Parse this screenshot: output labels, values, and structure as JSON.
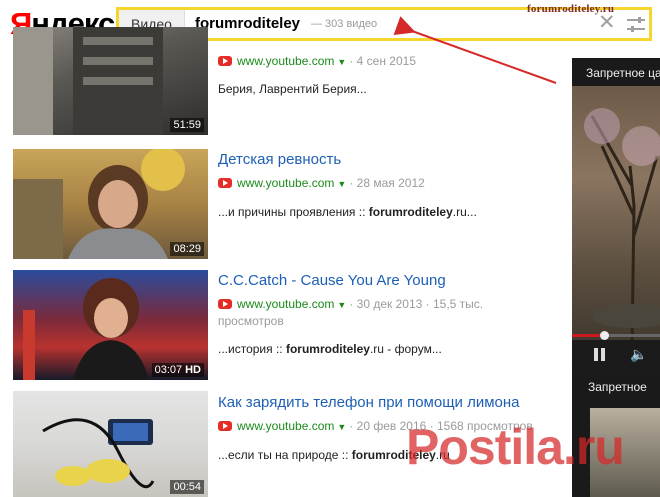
{
  "header": {
    "logo_first": "Я",
    "logo_rest": "ндекс",
    "search_tab": "Видео",
    "search_query": "forumroditeley",
    "search_count": "— 303 видео",
    "watermark": "forumroditeley.ru"
  },
  "results": [
    {
      "title": "",
      "site": "www.youtube.com",
      "date": "4 сен 2015",
      "snippet": "Берия, Лаврентий Берия...",
      "duration": "51:59"
    },
    {
      "title": "Детская ревность",
      "site": "www.youtube.com",
      "date": "28 мая 2012",
      "snippet_pre": "...и причины проявления :: ",
      "snippet_bold": "forumroditeley",
      "snippet_post": ".ru...",
      "duration": "08:29"
    },
    {
      "title": "C.C.Catch - Cause You Are Young",
      "site": "www.youtube.com",
      "date": "30 дек 2013",
      "views_line1": "15,5 тыс.",
      "views_line2": "просмотров",
      "snippet_pre": "...история :: ",
      "snippet_bold": "forumroditeley",
      "snippet_post": ".ru - форум...",
      "duration": "03:07",
      "badge": "HD"
    },
    {
      "title": "Как зарядить телефон при помощи лимона",
      "site": "www.youtube.com",
      "date": "20 фев 2016",
      "views": "1568 просмотров",
      "snippet_pre": "...если ты на природе :: ",
      "snippet_bold": "forumroditeley",
      "snippet_post": ".ru",
      "duration": "00:54"
    }
  ],
  "right_panel": {
    "title1": "Запретное ца",
    "title2": "Запретное"
  },
  "watermark": "Postila.ru",
  "colors": {
    "search_border": "#f6d62d",
    "link": "#1e5fb6",
    "site": "#1a8a1a",
    "youtube": "#e52d27",
    "arrow": "#d62a2a"
  },
  "icons": [
    "clear-icon",
    "settings-icon",
    "youtube-icon",
    "pause-icon",
    "volume-icon"
  ]
}
